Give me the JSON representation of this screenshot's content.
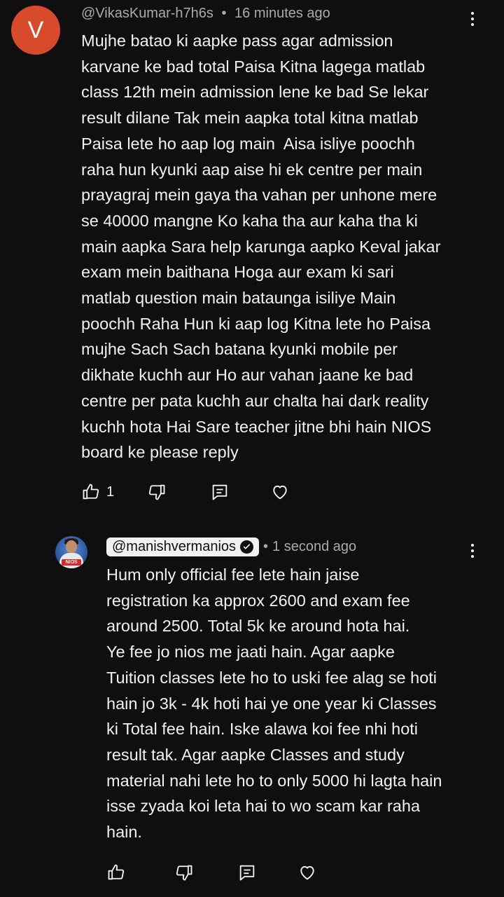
{
  "comment1": {
    "avatar_letter": "V",
    "author": "@VikasKumar-h7h6s",
    "separator": "•",
    "time": "16 minutes ago",
    "text": "Mujhe batao ki aapke pass agar admission\nkarvane ke bad total Paisa Kitna lagega matlab\nclass 12th mein admission lene ke bad Se lekar\nresult dilane Tak mein aapka total kitna matlab\nPaisa lete ho aap log main  Aisa isliye poochh\nraha hun kyunki aap aise hi ek centre per main\nprayagraj mein gaya tha vahan per unhone mere\nse 40000 mangne Ko kaha tha aur kaha tha ki\nmain aapka Sara help karunga aapko Keval jakar\nexam mein baithana Hoga aur exam ki sari\nmatlab question main bataunga isiliye Main\npoochh Raha Hun ki aap log Kitna lete ho Paisa\nmujhe Sach Sach batana kyunki mobile per\ndikhate kuchh aur Ho aur vahan jaane ke bad\ncentre per pata kuchh aur chalta hai dark reality\nkuchh hota Hai Sare teacher jitne bhi hain NIOS\nboard ke please reply",
    "like_count": "1",
    "icons": [
      "thumbs-up-icon",
      "thumbs-down-icon",
      "reply-icon",
      "heart-icon",
      "more-vert-icon"
    ]
  },
  "comment2": {
    "avatar_badge": "NIOS",
    "author": "@manishvermanios",
    "separator": "•",
    "time": "1 second ago",
    "text": "Hum only official fee lete hain jaise\nregistration ka approx 2600 and exam fee\naround 2500. Total 5k ke around hota hai.\nYe fee jo nios me jaati hain. Agar aapke\nTuition classes lete ho to uski fee alag se hoti\nhain jo 3k - 4k hoti hai ye one year ki Classes\nki Total fee hain. Iske alawa koi fee nhi hoti\nresult tak. Agar aapke Classes and study\nmaterial nahi lete ho to only 5000 hi lagta hain\nisse zyada koi leta hai to wo scam kar raha\nhain.",
    "icons": [
      "thumbs-up-icon",
      "thumbs-down-icon",
      "reply-icon",
      "heart-icon",
      "more-vert-icon",
      "verified-icon"
    ]
  },
  "colors": {
    "background": "#0f0f0f",
    "text": "#f1f1f1",
    "meta": "#aaaaaa",
    "avatar_v": "#d84a2c"
  }
}
